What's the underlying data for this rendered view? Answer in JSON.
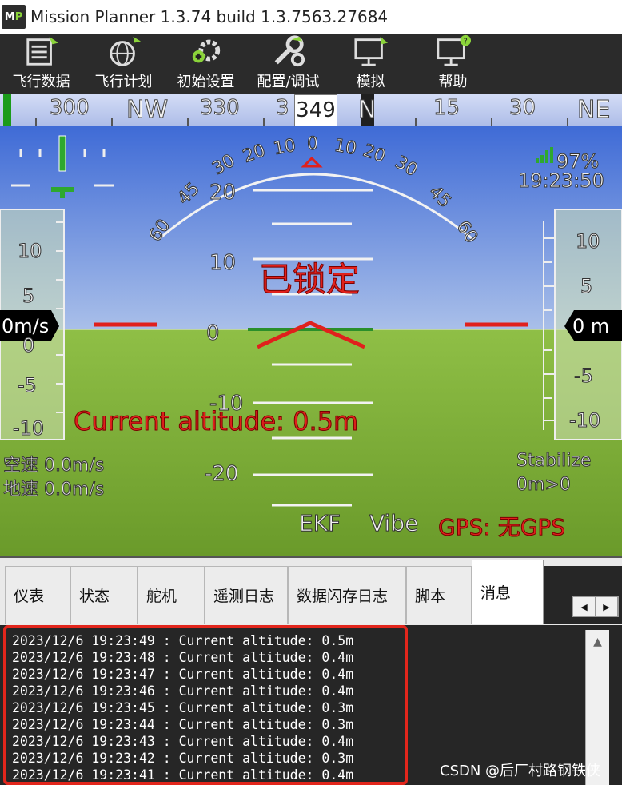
{
  "window": {
    "title": "Mission Planner 1.3.74 build 1.3.7563.27684",
    "logo_text_a": "M",
    "logo_text_b": "P"
  },
  "toolbar": {
    "buttons": [
      {
        "label": "飞行数据",
        "icon": "flight-data-icon"
      },
      {
        "label": "飞行计划",
        "icon": "flight-plan-icon"
      },
      {
        "label": "初始设置",
        "icon": "initial-setup-icon"
      },
      {
        "label": "配置/调试",
        "icon": "config-tuning-icon"
      },
      {
        "label": "模拟",
        "icon": "simulation-icon"
      },
      {
        "label": "帮助",
        "icon": "help-icon"
      }
    ]
  },
  "compass": {
    "labels": [
      "300",
      "NW",
      "330",
      "3",
      "N",
      "15",
      "30",
      "NE"
    ],
    "heading": "349"
  },
  "hud": {
    "battery": "97%",
    "time": "19:23:50",
    "status_big": "已锁定",
    "altitude_msg": "Current altitude: 0.5m",
    "airspeed": "空速 0.0m/s",
    "groundspeed": "地速 0.0m/s",
    "mode": "Stabilize",
    "mode_sub": "0m>0",
    "ekf": "EKF",
    "vibe": "Vibe",
    "gps": "GPS: 无GPS",
    "speed_readout": "0m/s",
    "alt_readout": "0 m",
    "left_scale": [
      "10",
      "5",
      "0",
      "-5",
      "-10"
    ],
    "right_scale": [
      "10",
      "5",
      "-5",
      "-10"
    ],
    "pitch_labels": [
      "20",
      "10",
      "0",
      "-10",
      "-20"
    ],
    "roll_labels_left": [
      "60",
      "45",
      "30",
      "20",
      "10"
    ],
    "roll_labels_right": [
      "10",
      "20",
      "30",
      "45",
      "60"
    ],
    "roll_center": "0",
    "colors": {
      "sky": "#4a73d9",
      "ground": "#7fb436",
      "warn": "#e0201c"
    }
  },
  "tabs": {
    "items": [
      "仪表",
      "状态",
      "舵机",
      "遥测日志",
      "数据闪存日志",
      "脚本",
      "消息"
    ],
    "active": "消息",
    "scroll_left": "◀",
    "scroll_right": "▶"
  },
  "messages": [
    "2023/12/6 19:23:49 : Current altitude: 0.5m",
    "2023/12/6 19:23:48 : Current altitude: 0.4m",
    "2023/12/6 19:23:47 : Current altitude: 0.4m",
    "2023/12/6 19:23:46 : Current altitude: 0.4m",
    "2023/12/6 19:23:45 : Current altitude: 0.3m",
    "2023/12/6 19:23:44 : Current altitude: 0.3m",
    "2023/12/6 19:23:43 : Current altitude: 0.4m",
    "2023/12/6 19:23:42 : Current altitude: 0.3m",
    "2023/12/6 19:23:41 : Current altitude: 0.4m"
  ],
  "scroll_up": "▲",
  "watermark": "CSDN @后厂村路钢铁侠"
}
